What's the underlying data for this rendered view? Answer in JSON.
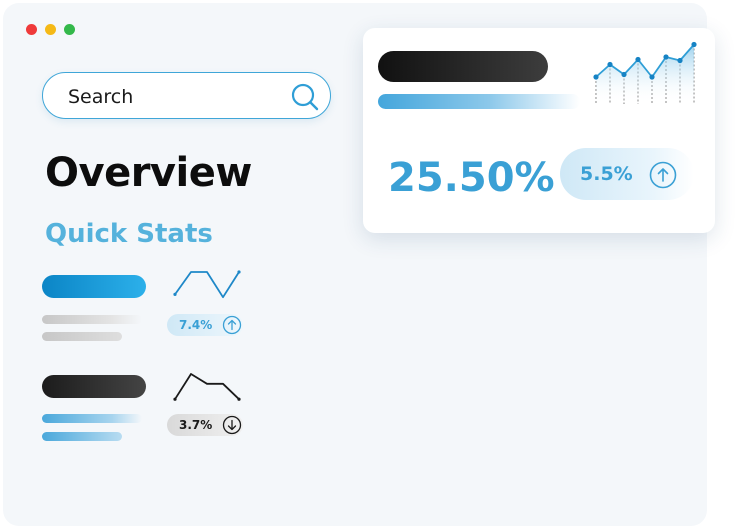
{
  "window": {
    "controls": [
      "close",
      "minimize",
      "maximize"
    ]
  },
  "search": {
    "placeholder": "Search",
    "icon": "search-icon"
  },
  "page": {
    "title": "Overview",
    "subtitle": "Quick Stats"
  },
  "quick_stats": [
    {
      "trend_label": "7.4%",
      "direction": "up",
      "direction_icon": "arrow-up-icon",
      "sparkline": [
        0.2,
        1.0,
        1.0,
        0.1,
        1.0
      ]
    },
    {
      "trend_label": "3.7%",
      "direction": "down",
      "direction_icon": "arrow-down-icon",
      "sparkline": [
        0.1,
        1.0,
        0.65,
        0.65,
        0.1
      ]
    }
  ],
  "stat_card": {
    "value": "25.50%",
    "change_label": "5.5%",
    "direction": "up",
    "direction_icon": "arrow-up-icon",
    "sparkline": [
      0.3,
      0.55,
      0.35,
      0.65,
      0.3,
      0.7,
      0.63,
      0.95
    ]
  },
  "colors": {
    "accent": "#3aa0d5",
    "accent_light": "#55b2dc",
    "dark": "#1a1a1a",
    "close": "#ef3a3a",
    "minimize": "#f5b916",
    "maximize": "#33b84a"
  }
}
